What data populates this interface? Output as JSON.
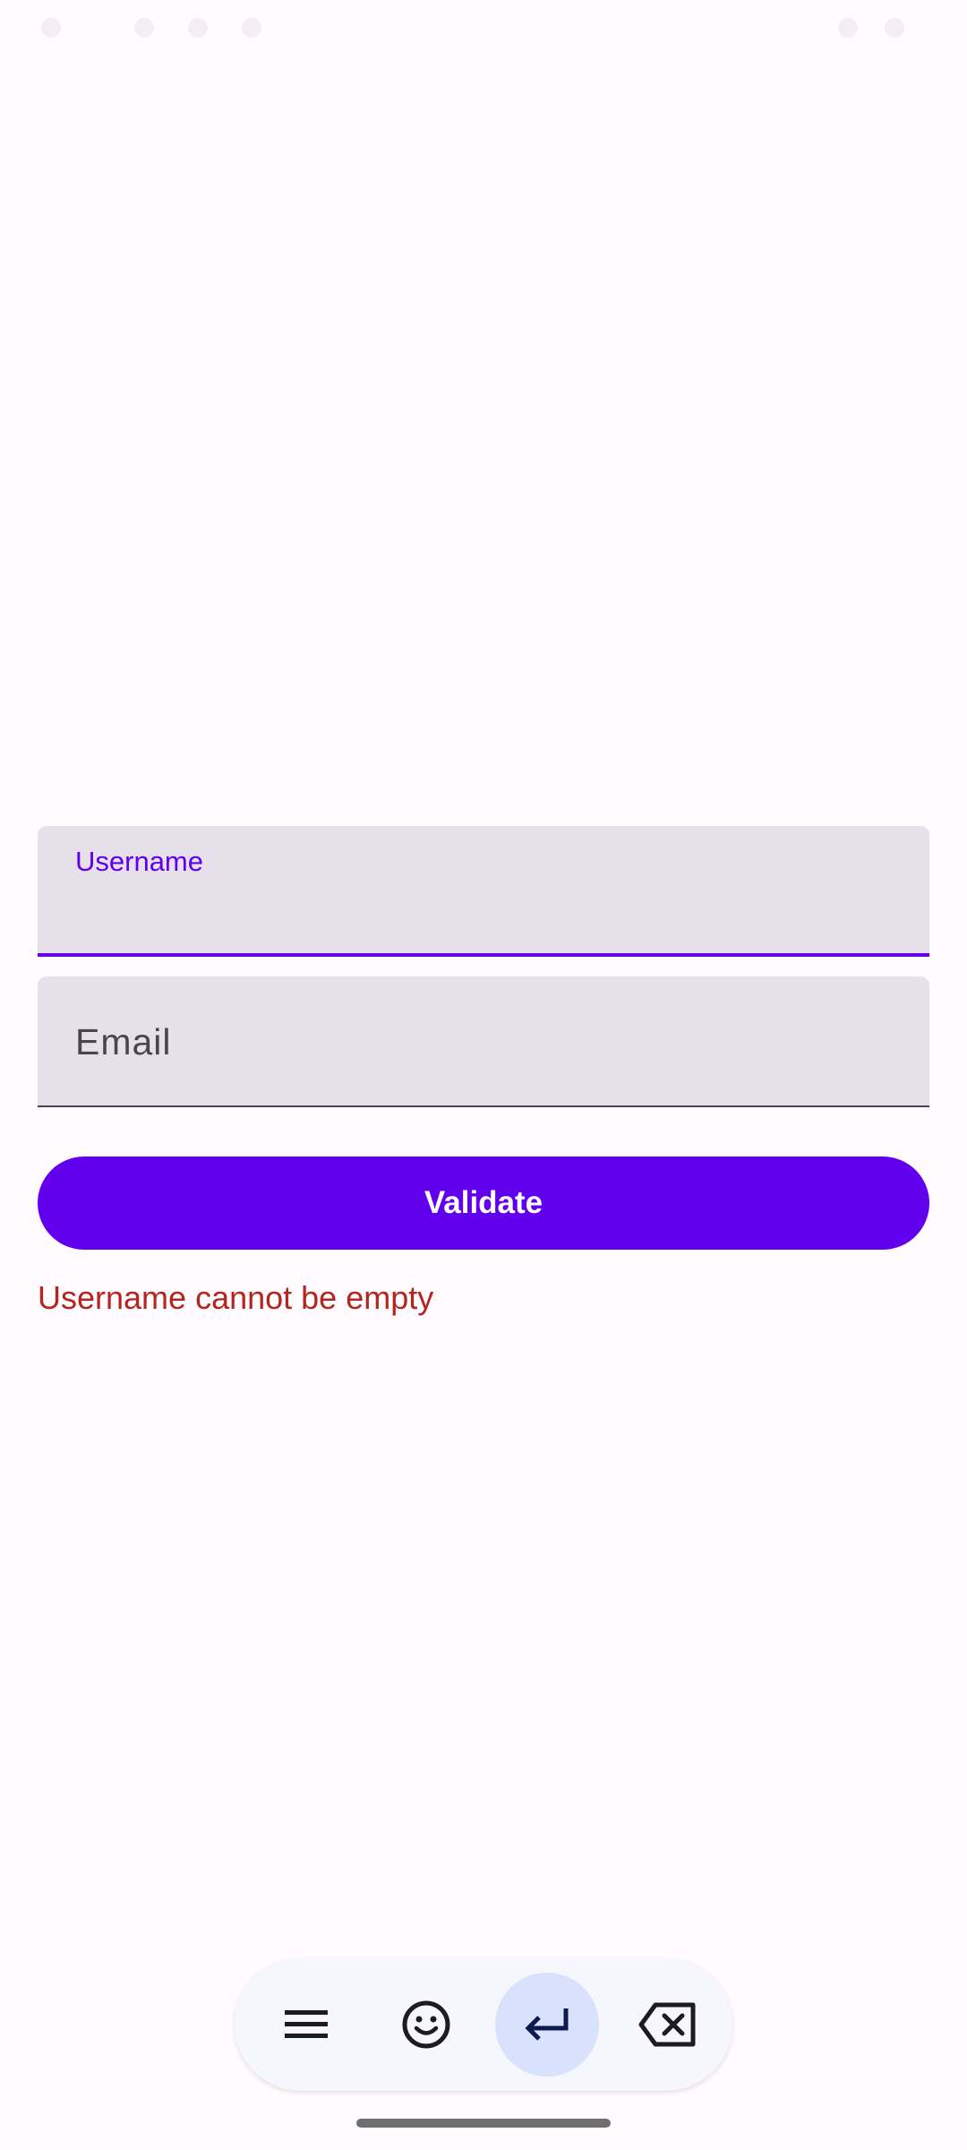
{
  "form": {
    "username": {
      "label": "Username",
      "value": ""
    },
    "email": {
      "label": "Email",
      "value": ""
    },
    "validate_label": "Validate",
    "error_message": "Username cannot be empty"
  },
  "keyboard_toolbar": {
    "buttons": [
      {
        "icon": "menu-icon"
      },
      {
        "icon": "emoji-icon"
      },
      {
        "icon": "enter-icon"
      },
      {
        "icon": "backspace-icon"
      }
    ]
  },
  "colors": {
    "background": "#fffbfe",
    "field_fill": "#e6e0ea",
    "accent": "#6200ee",
    "error": "#b3261e",
    "keyboard_toolbar": "#f6f7fc",
    "enter_highlight": "#d8e2fc"
  }
}
